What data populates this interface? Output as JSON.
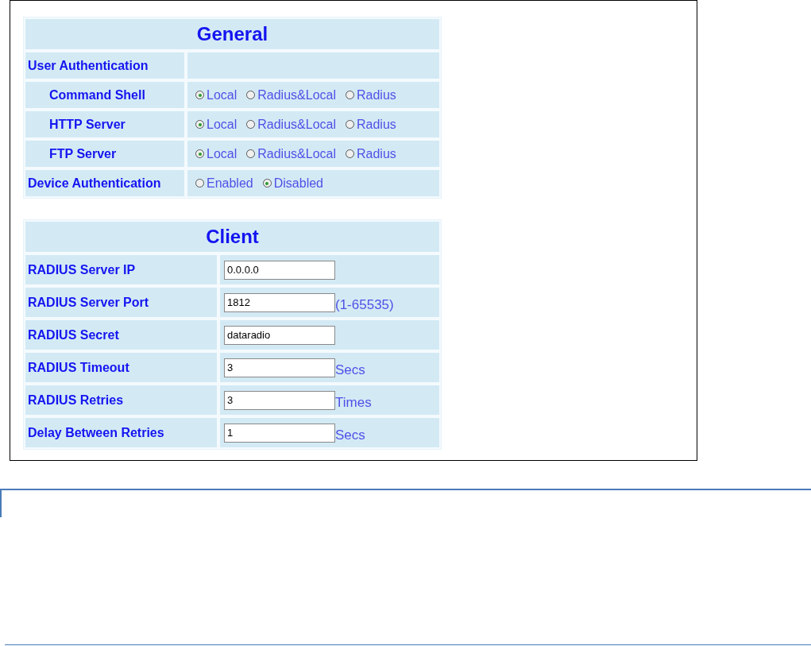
{
  "general": {
    "title": "General",
    "rows": [
      {
        "label": "User Authentication",
        "children": [
          {
            "label": "Command Shell",
            "options": [
              {
                "label": "Local",
                "selected": true
              },
              {
                "label": "Radius&Local",
                "selected": false
              },
              {
                "label": "Radius",
                "selected": false
              }
            ]
          },
          {
            "label": "HTTP Server",
            "options": [
              {
                "label": "Local",
                "selected": true
              },
              {
                "label": "Radius&Local",
                "selected": false
              },
              {
                "label": "Radius",
                "selected": false
              }
            ]
          },
          {
            "label": "FTP Server",
            "options": [
              {
                "label": "Local",
                "selected": true
              },
              {
                "label": "Radius&Local",
                "selected": false
              },
              {
                "label": "Radius",
                "selected": false
              }
            ]
          }
        ]
      },
      {
        "label": "Device Authentication",
        "options": [
          {
            "label": "Enabled",
            "selected": false
          },
          {
            "label": "Disabled",
            "selected": true
          }
        ]
      }
    ]
  },
  "client": {
    "title": "Client",
    "rows": [
      {
        "label": "RADIUS Server IP",
        "value": "0.0.0.0"
      },
      {
        "label": "RADIUS Server Port",
        "value": "1812",
        "unit": "(1-65535)"
      },
      {
        "label": "RADIUS Secret",
        "value": "dataradio"
      },
      {
        "label": "RADIUS Timeout",
        "value": "3",
        "unit": "Secs"
      },
      {
        "label": "RADIUS Retries",
        "value": "3",
        "unit": "Times"
      },
      {
        "label": "Delay Between Retries",
        "value": "1",
        "unit": "Secs"
      }
    ]
  }
}
